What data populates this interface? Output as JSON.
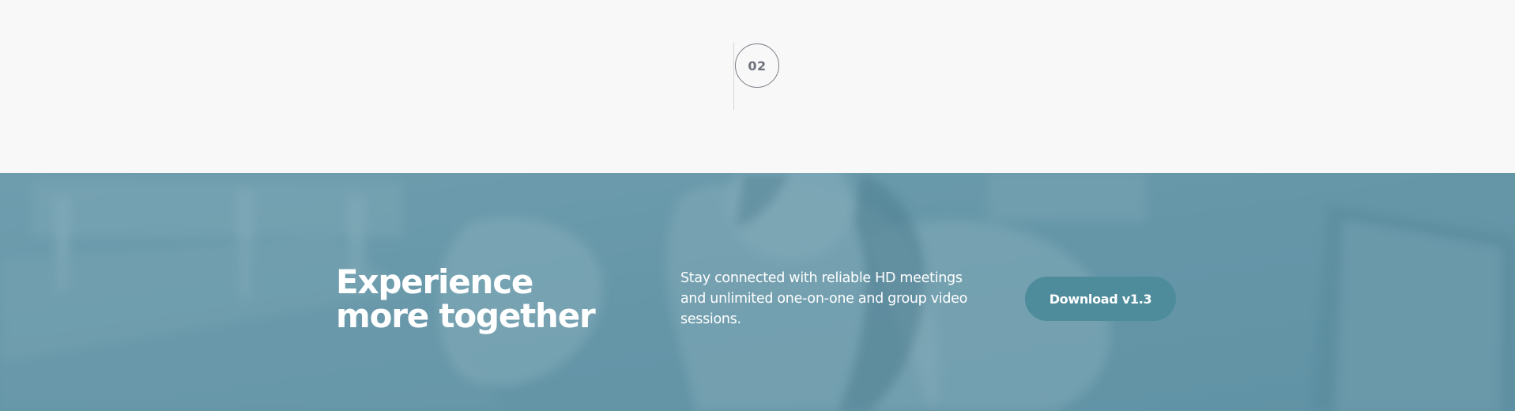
{
  "step": {
    "number": "02"
  },
  "banner": {
    "headline": "Experience more together",
    "description": "Stay connected with reliable HD meetings and unlimited one-on-one and group video sessions.",
    "download_label": "Download v1.3",
    "background_image": "blurred-photo-woman-on-phone",
    "colors": {
      "overlay": "#548da1",
      "button": "#4e8c9c",
      "text": "#ffffff"
    }
  },
  "top_section": {
    "background": "#f8f8f8"
  }
}
